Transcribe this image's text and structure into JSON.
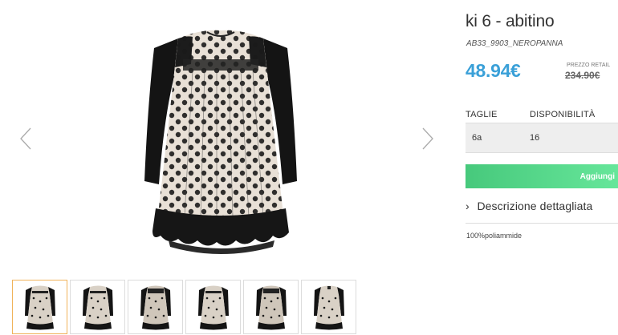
{
  "product": {
    "title": "ki 6 - abitino",
    "sku": "AB33_9903_NEROPANNA",
    "price": "48.94€",
    "retail_label": "PREZZO RETAIL",
    "retail_price": "234.90€"
  },
  "sizes_table": {
    "headers": [
      "TAGLIE",
      "DISPONIBILITÀ"
    ],
    "rows": [
      [
        "6a",
        "16"
      ]
    ]
  },
  "add_button": {
    "label": "Aggiungi",
    "color": "#52d186"
  },
  "description": {
    "toggle_label": "Descrizione dettagliata",
    "chevron": "›",
    "text": "100%poliammide"
  },
  "gallery": {
    "prev_icon": "chevron-left-icon",
    "next_icon": "chevron-right-icon",
    "thumbnail_count": 6,
    "active_thumbnail": 1
  },
  "colors": {
    "price": "#3aa0d8",
    "active_thumb_border": "#f0b35a"
  }
}
